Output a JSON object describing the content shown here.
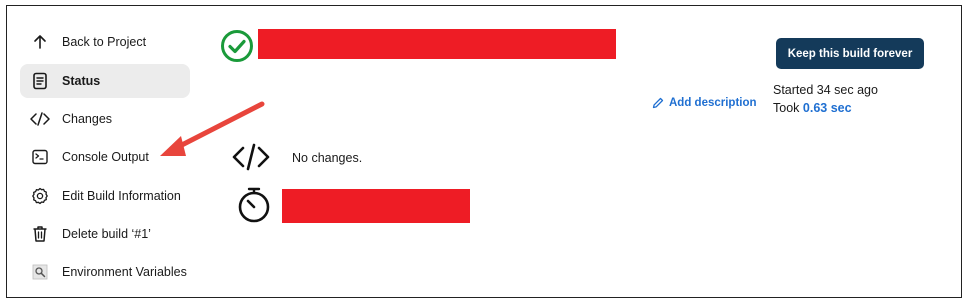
{
  "sidebar": {
    "items": [
      {
        "label": "Back to Project",
        "icon": "arrow-up-icon"
      },
      {
        "label": "Status",
        "icon": "document-icon",
        "active": true
      },
      {
        "label": "Changes",
        "icon": "code-icon"
      },
      {
        "label": "Console Output",
        "icon": "terminal-icon"
      },
      {
        "label": "Edit Build Information",
        "icon": "gear-icon"
      },
      {
        "label": "Delete build ‘#1’",
        "icon": "trash-icon"
      },
      {
        "label": "Environment Variables",
        "icon": "magnifier-icon"
      }
    ]
  },
  "header": {
    "status_icon": "check-circle-icon",
    "status_color": "#1a9a3a"
  },
  "actions": {
    "keep_forever_label": "Keep this build forever",
    "add_description_label": "Add description"
  },
  "build_info": {
    "started": "Started 34 sec ago",
    "took_prefix": "Took",
    "took_duration": "0.63 sec"
  },
  "changes": {
    "text": "No changes."
  },
  "colors": {
    "accent": "#1f6fd1",
    "button_bg": "#143a5a",
    "redaction": "#ee1c25",
    "annotation_arrow": "#e8453c"
  }
}
